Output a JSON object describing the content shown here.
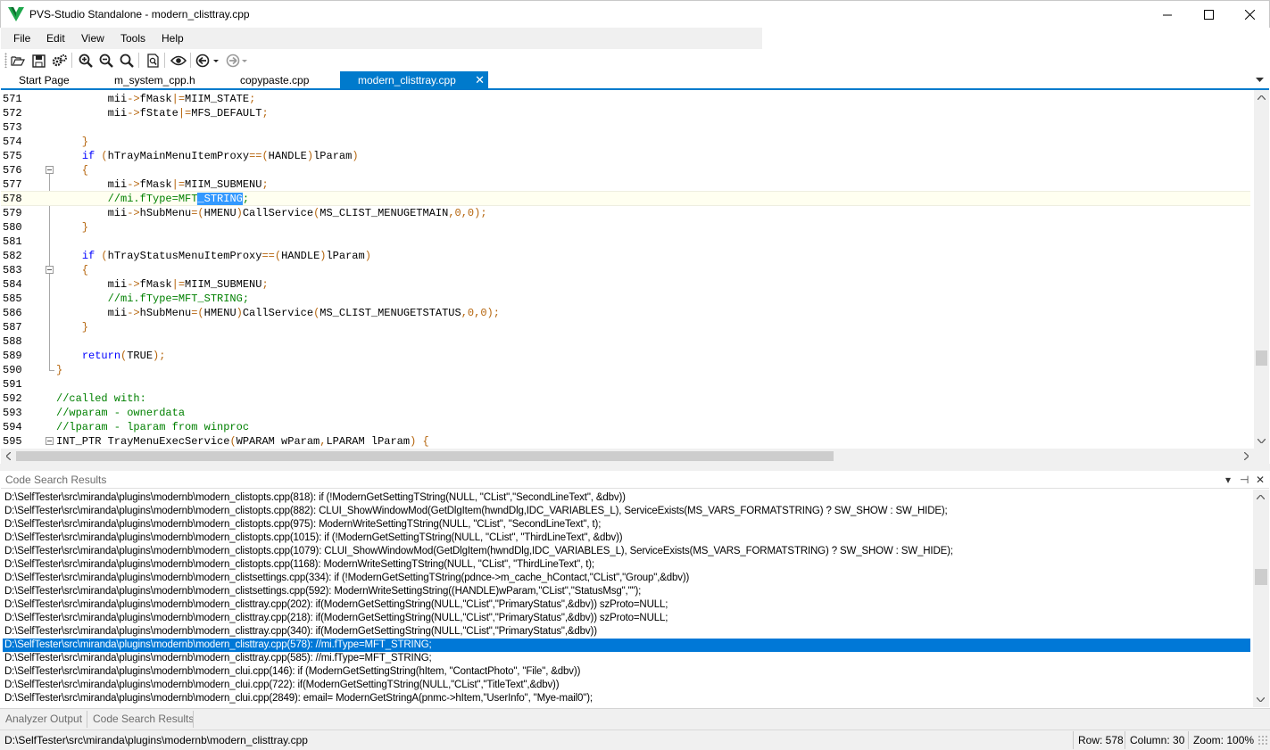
{
  "window": {
    "title": "PVS-Studio Standalone - modern_clisttray.cpp",
    "buttons": [
      "minimize",
      "maximize",
      "close"
    ],
    "brand_color": "#1fa84c"
  },
  "menu": [
    "File",
    "Edit",
    "View",
    "Tools",
    "Help"
  ],
  "toolbar": {
    "icons": [
      "open-folder-icon",
      "save-icon",
      "settings-gears-icon",
      "zoom-in-icon",
      "zoom-out-icon",
      "zoom-reset-icon",
      "search-file-icon",
      "eye-icon",
      "navigate-back-icon",
      "navigate-forward-icon"
    ]
  },
  "tabs": [
    {
      "label": "Start Page",
      "active": false
    },
    {
      "label": "m_system_cpp.h",
      "active": false
    },
    {
      "label": "copypaste.cpp",
      "active": false
    },
    {
      "label": "modern_clisttray.cpp",
      "active": true
    }
  ],
  "tab_close_glyph": "✕",
  "code": [
    {
      "n": "571",
      "t": "        mii->fMask|=MIIM_STATE;"
    },
    {
      "n": "572",
      "t": "        mii->fState|=MFS_DEFAULT;"
    },
    {
      "n": "573",
      "t": ""
    },
    {
      "n": "574",
      "t": "    }"
    },
    {
      "n": "575",
      "t": "    if (hTrayMainMenuItemProxy==(HANDLE)lParam)"
    },
    {
      "n": "576",
      "t": "    {"
    },
    {
      "n": "577",
      "t": "        mii->fMask|=MIIM_SUBMENU;"
    },
    {
      "n": "578",
      "t": "        //mi.fType=MFT_STRING;"
    },
    {
      "n": "579",
      "t": "        mii->hSubMenu=(HMENU)CallService(MS_CLIST_MENUGETMAIN,0,0);"
    },
    {
      "n": "580",
      "t": "    }"
    },
    {
      "n": "581",
      "t": ""
    },
    {
      "n": "582",
      "t": "    if (hTrayStatusMenuItemProxy==(HANDLE)lParam)"
    },
    {
      "n": "583",
      "t": "    {"
    },
    {
      "n": "584",
      "t": "        mii->fMask|=MIIM_SUBMENU;"
    },
    {
      "n": "585",
      "t": "        //mi.fType=MFT_STRING;"
    },
    {
      "n": "586",
      "t": "        mii->hSubMenu=(HMENU)CallService(MS_CLIST_MENUGETSTATUS,0,0);"
    },
    {
      "n": "587",
      "t": "    }"
    },
    {
      "n": "588",
      "t": ""
    },
    {
      "n": "589",
      "t": "    return(TRUE);"
    },
    {
      "n": "590",
      "t": "}"
    },
    {
      "n": "591",
      "t": ""
    },
    {
      "n": "592",
      "t": "//called with:"
    },
    {
      "n": "593",
      "t": "//wparam - ownerdata"
    },
    {
      "n": "594",
      "t": "//lparam - lparam from winproc"
    },
    {
      "n": "595",
      "t": "INT_PTR TrayMenuExecService(WPARAM wParam,LPARAM lParam) {"
    }
  ],
  "code_panel": {
    "title": "Code Search Results",
    "controls": [
      "▾",
      "⊣",
      "✕"
    ],
    "results": [
      "D:\\SelfTester\\src\\miranda\\plugins\\modernb\\modern_clistopts.cpp(818): if (!ModernGetSettingTString(NULL, \"CList\",\"SecondLineText\", &dbv))",
      "D:\\SelfTester\\src\\miranda\\plugins\\modernb\\modern_clistopts.cpp(882): CLUI_ShowWindowMod(GetDlgItem(hwndDlg,IDC_VARIABLES_L), ServiceExists(MS_VARS_FORMATSTRING) ? SW_SHOW : SW_HIDE);",
      "D:\\SelfTester\\src\\miranda\\plugins\\modernb\\modern_clistopts.cpp(975): ModernWriteSettingTString(NULL, \"CList\", \"SecondLineText\", t);",
      "D:\\SelfTester\\src\\miranda\\plugins\\modernb\\modern_clistopts.cpp(1015): if (!ModernGetSettingTString(NULL, \"CList\", \"ThirdLineText\", &dbv))",
      "D:\\SelfTester\\src\\miranda\\plugins\\modernb\\modern_clistopts.cpp(1079): CLUI_ShowWindowMod(GetDlgItem(hwndDlg,IDC_VARIABLES_L), ServiceExists(MS_VARS_FORMATSTRING) ? SW_SHOW : SW_HIDE);",
      "D:\\SelfTester\\src\\miranda\\plugins\\modernb\\modern_clistopts.cpp(1168): ModernWriteSettingTString(NULL, \"CList\", \"ThirdLineText\", t);",
      "D:\\SelfTester\\src\\miranda\\plugins\\modernb\\modern_clistsettings.cpp(334): if (!ModernGetSettingTString(pdnce->m_cache_hContact,\"CList\",\"Group\",&dbv))",
      "D:\\SelfTester\\src\\miranda\\plugins\\modernb\\modern_clistsettings.cpp(592): ModernWriteSettingString((HANDLE)wParam,\"CList\",\"StatusMsg\",\"\");",
      "D:\\SelfTester\\src\\miranda\\plugins\\modernb\\modern_clisttray.cpp(202): if(ModernGetSettingString(NULL,\"CList\",\"PrimaryStatus\",&dbv)) szProto=NULL;",
      "D:\\SelfTester\\src\\miranda\\plugins\\modernb\\modern_clisttray.cpp(218): if(ModernGetSettingString(NULL,\"CList\",\"PrimaryStatus\",&dbv)) szProto=NULL;",
      "D:\\SelfTester\\src\\miranda\\plugins\\modernb\\modern_clisttray.cpp(340): if(ModernGetSettingString(NULL,\"CList\",\"PrimaryStatus\",&dbv))",
      "D:\\SelfTester\\src\\miranda\\plugins\\modernb\\modern_clisttray.cpp(578): //mi.fType=MFT_STRING;",
      "D:\\SelfTester\\src\\miranda\\plugins\\modernb\\modern_clisttray.cpp(585): //mi.fType=MFT_STRING;",
      "D:\\SelfTester\\src\\miranda\\plugins\\modernb\\modern_clui.cpp(146): if (ModernGetSettingString(hItem, \"ContactPhoto\", \"File\", &dbv))",
      "D:\\SelfTester\\src\\miranda\\plugins\\modernb\\modern_clui.cpp(722): if(ModernGetSettingTString(NULL,\"CList\",\"TitleText\",&dbv))",
      "D:\\SelfTester\\src\\miranda\\plugins\\modernb\\modern_clui.cpp(2849): email= ModernGetStringA(pnmc->hItem,\"UserInfo\", \"Mye-mail0\");"
    ],
    "selected_index": 11
  },
  "bottom_tabs": [
    "Analyzer Output",
    "Code Search Results"
  ],
  "status": {
    "path": "D:\\SelfTester\\src\\miranda\\plugins\\modernb\\modern_clisttray.cpp",
    "row": "Row: 578",
    "column": "Column: 30",
    "zoom": "Zoom: 100%"
  },
  "colors": {
    "accent": "#007acc",
    "selection": "#0078d7",
    "keyword": "#0000ff",
    "comment": "#008000"
  }
}
